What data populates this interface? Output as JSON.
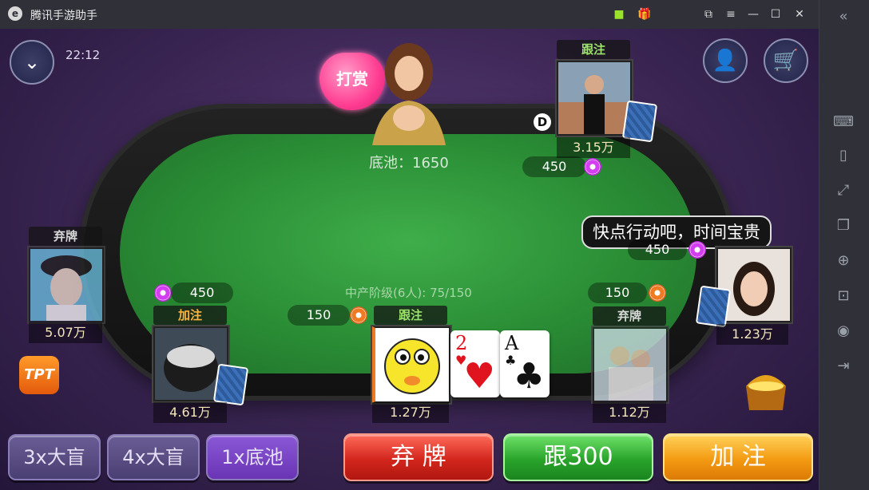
{
  "window": {
    "title": "腾讯手游助手"
  },
  "hud": {
    "time": "22:12",
    "reward_label": "打赏",
    "pot_text": "底池：1650",
    "table_info": "中产阶级(6人): 75/150",
    "dealer_marker": "D"
  },
  "chat_bubble": "快点行动吧，时间宝贵",
  "players": {
    "top": {
      "status": "跟注",
      "stack": "3.15万",
      "bet": "450",
      "chip_color": "#d33ef0"
    },
    "right": {
      "stack": "1.23万",
      "bet": "450",
      "chip_color": "#d33ef0"
    },
    "left": {
      "status": "弃牌",
      "stack": "5.07万"
    },
    "bottom_left": {
      "status": "加注",
      "stack": "4.61万",
      "bet": "450",
      "chip_color": "#d33ef0"
    },
    "self": {
      "status": "跟注",
      "stack": "1.27万",
      "bet": "150",
      "chip_color": "#f07a22"
    },
    "bottom_right": {
      "status": "弃牌",
      "stack": "1.12万",
      "bet": "150",
      "chip_color": "#f07a22"
    }
  },
  "hand": [
    {
      "rank": "2",
      "suit": "♥",
      "color": "#e0141e"
    },
    {
      "rank": "A",
      "suit": "♣",
      "color": "#111111"
    }
  ],
  "actions": {
    "blind3": "3x大盲",
    "blind4": "4x大盲",
    "pot1": "1x底池",
    "fold": "弃 牌",
    "call": "跟300",
    "raise": "加 注"
  },
  "logo_text": "TPT",
  "colors": {
    "felt": "#2a8d35",
    "fold": "#d3261d",
    "call": "#2aa42b",
    "raise": "#f49a12",
    "status_call": "#9be26a",
    "status_raise": "#ffb43a",
    "status_fold": "#d8d8d8"
  }
}
